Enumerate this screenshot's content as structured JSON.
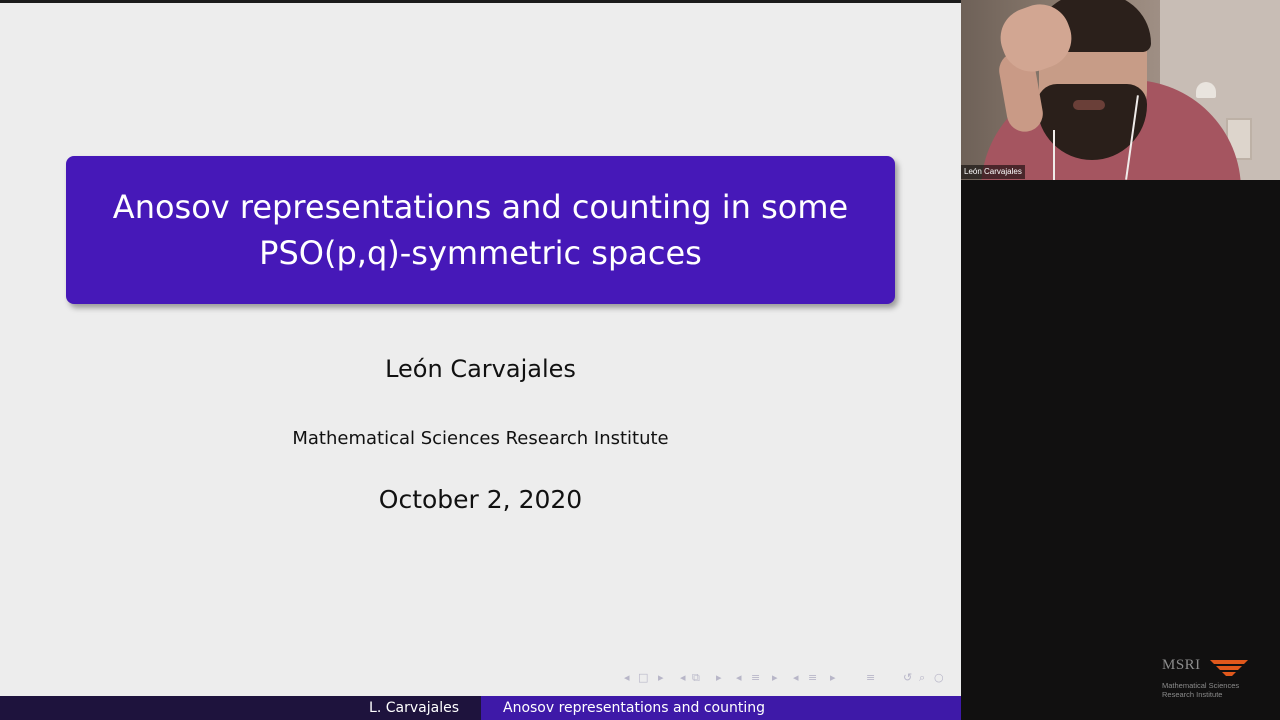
{
  "slide": {
    "title": "Anosov representations and counting in some PSO(p,q)-symmetric spaces",
    "author": "León Carvajales",
    "institute": "Mathematical Sciences Research Institute",
    "date": "October 2, 2020",
    "footer_left": "L. Carvajales",
    "footer_right": "Anosov representations and counting",
    "title_box_color": "#4618b8",
    "footer_left_color": "#1e133d",
    "footer_right_color": "#3e19a8"
  },
  "video": {
    "participant_name": "León Carvajales"
  },
  "logo": {
    "mark": "MSRI",
    "line1": "Mathematical Sciences",
    "line2": "Research Institute",
    "accent_color": "#e0581c"
  },
  "nav_icons": [
    "nav-left-icon",
    "frame-icon",
    "nav-right-icon",
    "nav-left-icon",
    "subsection-icon",
    "nav-right-icon",
    "nav-left-icon",
    "section-icon",
    "nav-right-icon",
    "nav-left-icon",
    "section-icon",
    "nav-right-icon",
    "appendix-icon",
    "undo-icon",
    "search-icon",
    "zoom-icon"
  ]
}
